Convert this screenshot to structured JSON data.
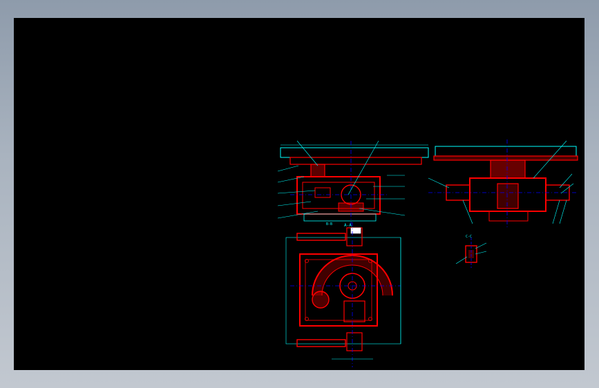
{
  "app": {
    "colors": {
      "background_gradient_top": "#8e9bab",
      "background_gradient_bottom": "#c2c8d0",
      "canvas": "#000000",
      "outline": "#ff0000",
      "dimension": "#00ffff",
      "centerline": "#0000ff",
      "annotation": "#ffffff"
    }
  },
  "labels": {
    "section_aa": "A-A",
    "section_bb": "B-B",
    "section_cc": "C-C"
  }
}
